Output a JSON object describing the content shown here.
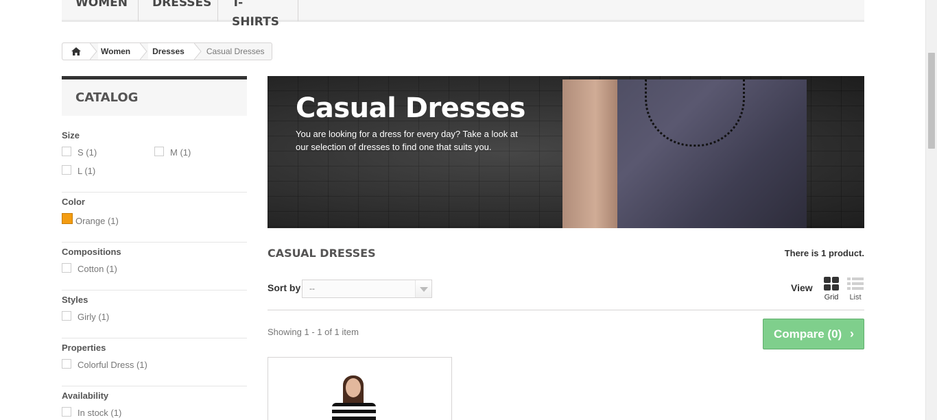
{
  "top_menu": {
    "items": [
      {
        "label": "Women"
      },
      {
        "label": "Dresses"
      },
      {
        "label": "T-shirts"
      }
    ]
  },
  "breadcrumb": {
    "home_icon": "home-icon",
    "items": [
      "Women",
      "Dresses"
    ],
    "current": "Casual Dresses"
  },
  "sidebar": {
    "title": "CATALOG",
    "filters": {
      "size": {
        "title": "Size",
        "options": [
          "S (1)",
          "M (1)",
          "L (1)"
        ]
      },
      "color": {
        "title": "Color",
        "option": "Orange (1)",
        "swatch": "#F39C11"
      },
      "compositions": {
        "title": "Compositions",
        "option": "Cotton (1)"
      },
      "styles": {
        "title": "Styles",
        "option": "Girly (1)"
      },
      "properties": {
        "title": "Properties",
        "option": "Colorful Dress (1)"
      },
      "availability": {
        "title": "Availability",
        "option": "In stock (1)"
      }
    }
  },
  "banner": {
    "title": "Casual Dresses",
    "description": "You are looking for a dress for every day? Take a look at our selection of dresses to find one that suits you."
  },
  "category": {
    "name": "CASUAL DRESSES",
    "count_text": "There is 1 product."
  },
  "sort": {
    "label": "Sort by",
    "selected": "--"
  },
  "view": {
    "label": "View",
    "grid_label": "Grid",
    "list_label": "List"
  },
  "showing": "Showing 1 - 1 of 1 item",
  "compare": {
    "label": "Compare (0)",
    "chevron": "›",
    "color": "#7fcf8c"
  }
}
